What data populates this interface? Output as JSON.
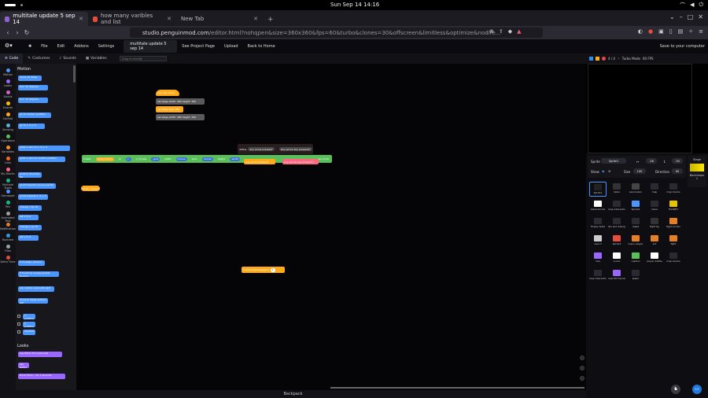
{
  "os": {
    "clock": "Sun Sep 14  14:16"
  },
  "browser": {
    "tabs": [
      {
        "label": "multitale update 5 sep 14",
        "active": true
      },
      {
        "label": "how many varibles and list",
        "active": false
      },
      {
        "label": "New Tab",
        "active": false
      }
    ],
    "url_host": "studio.penguinmod.com",
    "url_path": "/editor.html?nohqpen&size=360x360&fps=60&turbo&clones=30&offscreen&limitless&optimize&nodire..."
  },
  "menubar": {
    "items": [
      "File",
      "Edit",
      "Addons",
      "Settings"
    ],
    "project_title": "multitale update 5 sep 14",
    "see_page": "See Project Page",
    "upload": "Upload",
    "back": "Back to Home",
    "save": "Save to your computer"
  },
  "editor_tabs": [
    "Code",
    "Costumes",
    "Sounds",
    "Variables"
  ],
  "search": {
    "placeholder": "Drag to modify"
  },
  "stage_header": {
    "counter": "4 / 4",
    "turbo": "Turbo Mode",
    "fps": "60 FPS"
  },
  "categories": [
    "Motion",
    "Looks",
    "Sound",
    "Events",
    "Control",
    "Sensing",
    "Operators",
    "Variables",
    "Lists",
    "My Blocks",
    "Multiple Types",
    "Gamepad",
    "Pen",
    "Animated Text",
    "Notifications",
    "Runtime",
    "Files",
    "Delta Time"
  ],
  "palette": {
    "motion_header": "Motion",
    "looks_header": "Looks",
    "checks": [
      "x position",
      "y position",
      "direction"
    ],
    "blocks": [
      "move 10 steps",
      "turn 15 degrees",
      "turn 15 degrees",
      "go to random position",
      "go to x: 0 y: 0",
      "glide 1 secs to x: 0 y: 0",
      "glide 1 secs to random position",
      "point in direction 90",
      "point towards mouse-pointer",
      "point towards x: 0 y: 0",
      "change x by 10",
      "set x to 0",
      "change y by 10",
      "set y to 0",
      "if on edge, bounce",
      "if touching mouse-pointer bounce",
      "set rotation style left-right",
      "move to stage bottom-left"
    ],
    "looks_blocks": [
      "say Hello! for 2 seconds",
      "say Hello!",
      "think Hmm... for 2 seconds"
    ]
  },
  "code": {
    "stack_top": [
      "when flag clicked",
      "set stage width: 480 height: 360",
      "set stage size: 360",
      "set stage width: 480 height: 360"
    ],
    "long_block": {
      "items": [
        "create",
        "setup button",
        "at",
        "x:",
        "y: mouse",
        "ypos",
        "width",
        "mouse",
        "xpos",
        "mouse",
        "height",
        "sprite"
      ],
      "tail": "any ticks"
    },
    "ctl_block": [
      "define",
      "any arrow pressed?",
      "any (arrow key pressed?)"
    ],
    "orange_small": "when i receive",
    "orange_mid": "broadcast(message1)"
  },
  "sprite_info": {
    "sprite_label": "Sprite",
    "sprite_name": "Sprite1",
    "x": "-26",
    "y": "-30",
    "show_label": "Show",
    "size_label": "Size",
    "size": "100",
    "direction_label": "Direction",
    "direction": "90"
  },
  "stage_panel": {
    "label": "Stage",
    "backdrops_label": "Backdrops",
    "backdrops_count": "1"
  },
  "sprites": [
    "Sprite1",
    "table",
    "sword-skin",
    "map",
    "map blocks",
    "table blocks",
    "map interaction",
    "Sprite2",
    "menu",
    "FLOWEY",
    "flowey texts",
    "fps and debug",
    "map2",
    "fight bg",
    "fight border",
    "sword",
    "Sprite3",
    "menu player",
    "act",
    "fight",
    "mini",
    "cursor",
    "caption",
    "player battle",
    "map blocks",
    "map interaction",
    "new fish blocks",
    "water"
  ],
  "backpack": "Backpack",
  "colors": {
    "motion": "#4c97ff",
    "looks": "#9966ff",
    "events": "#ffab19",
    "pen": "#59c059",
    "operators": "#ff6680"
  }
}
